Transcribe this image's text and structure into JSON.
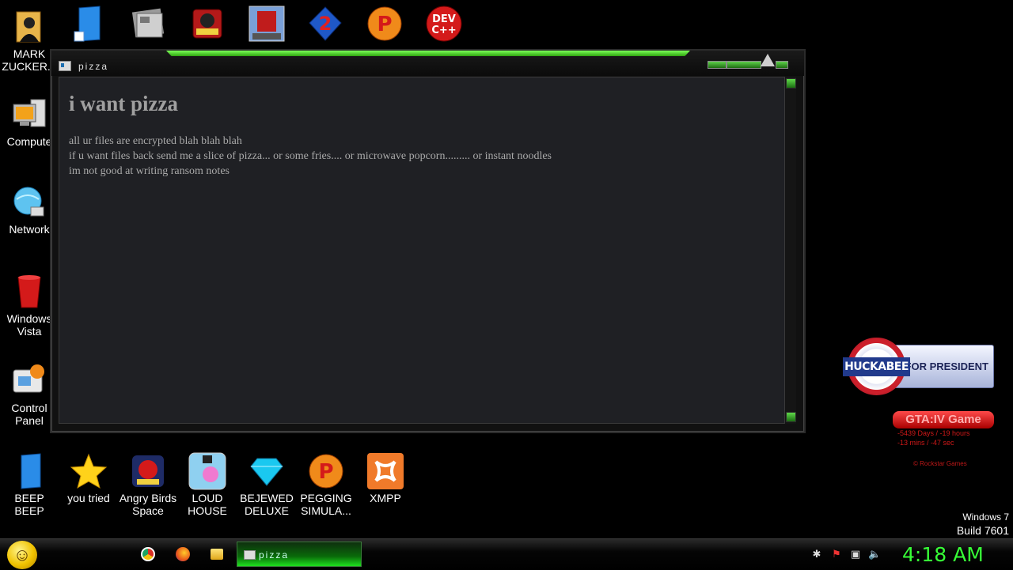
{
  "desktop": {
    "left_icons": [
      {
        "label": "MARK\nZUCKER...",
        "icon": "folder-person-icon"
      },
      {
        "label": "Compute",
        "icon": "computer-icon"
      },
      {
        "label": "Network",
        "icon": "network-globe-icon"
      },
      {
        "label": "Windows\nVista",
        "icon": "recycle-bin-icon"
      },
      {
        "label": "Control\nPanel",
        "icon": "control-panel-icon"
      }
    ],
    "bottom_icons": [
      {
        "label": "BEEP\nBEEP",
        "icon": "blue-app-icon"
      },
      {
        "label": "you tried",
        "icon": "star-icon"
      },
      {
        "label": "Angry Birds\nSpace",
        "icon": "angry-birds-icon"
      },
      {
        "label": "LOUD\nHOUSE",
        "icon": "loud-house-icon"
      },
      {
        "label": "BEJEWED\nDELUXE",
        "icon": "gem-icon"
      },
      {
        "label": "PEGGING\nSIMULA...",
        "icon": "peggle-icon"
      },
      {
        "label": "XMPP",
        "icon": "xampp-icon"
      }
    ],
    "top_icons": [
      {
        "icon": "blue-app-icon"
      },
      {
        "icon": "newspaper-icon"
      },
      {
        "icon": "star-wars-game-icon"
      },
      {
        "icon": "minecraft-icon"
      },
      {
        "icon": "portal-2-icon"
      },
      {
        "icon": "peggle-icon"
      },
      {
        "icon": "dev-cpp-icon",
        "text": "DEV\nC++"
      }
    ]
  },
  "window": {
    "title": "pizza",
    "heading": "i want pizza",
    "lines": [
      "all ur files are encrypted blah blah blah",
      "if u want files back send me a slice of pizza... or some fries.... or microwave popcorn......... or instant noodles",
      "im not good at writing ransom notes"
    ]
  },
  "widgets": {
    "huckabee": {
      "name": "HUCKABEE",
      "text": "FOR PRESIDENT"
    },
    "gta": {
      "button": "GTA:IV Game",
      "line1": "-5439 Days / -19 hours",
      "line2": "-13 mins / -47 sec",
      "copyright": "© Rockstar Games"
    },
    "build": {
      "line1": "Windows 7",
      "line2": "Build 7601"
    }
  },
  "taskbar": {
    "task_label": "pizza",
    "clock": "4:18 AM",
    "pinned": [
      "chrome-icon",
      "firefox-icon",
      "explorer-folder-icon"
    ],
    "tray": [
      "bluetooth-icon",
      "action-center-flag-icon",
      "network-tray-icon",
      "volume-icon"
    ]
  },
  "colors": {
    "clock": "#37ff37",
    "accent_green": "#2fa510",
    "gta_red": "#d01818"
  }
}
